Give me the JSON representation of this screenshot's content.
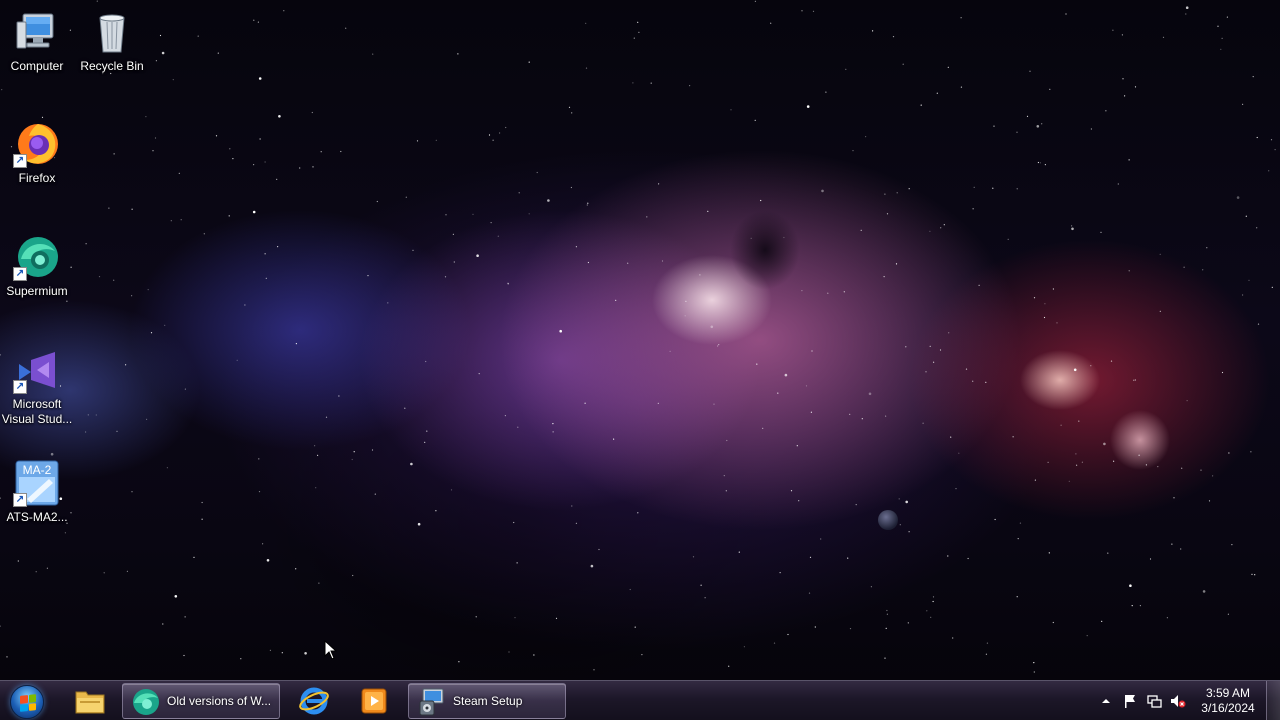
{
  "desktop": {
    "icons": [
      {
        "label": "Computer",
        "icon": "computer-icon"
      },
      {
        "label": "Recycle Bin",
        "icon": "recycle-bin-icon"
      },
      {
        "label": "Firefox",
        "icon": "firefox-icon"
      },
      {
        "label": "Supermium",
        "icon": "supermium-icon"
      },
      {
        "label": "Microsoft\nVisual Stud...",
        "line1": "Microsoft",
        "line2": "Visual Stud...",
        "icon": "visual-studio-icon"
      },
      {
        "label": "ATS-MA2...",
        "icon": "ats-ma2-icon",
        "badge": "MA-2"
      }
    ]
  },
  "taskbar": {
    "start_button": {
      "icon": "windows-start-orb-icon"
    },
    "pinned": [
      {
        "name": "File Explorer",
        "icon": "folder-icon"
      },
      {
        "name": "Internet Explorer",
        "icon": "internet-explorer-icon"
      },
      {
        "name": "Media Player",
        "icon": "media-player-icon"
      }
    ],
    "tasks": [
      {
        "title": "Old versions of W...",
        "icon": "supermium-icon"
      },
      {
        "title": "Steam Setup",
        "icon": "steam-setup-icon"
      }
    ],
    "tray": {
      "icons": [
        "show-hidden-icons-chevron",
        "action-center-flag-icon",
        "network-icon",
        "volume-muted-icon"
      ],
      "time": "3:59 AM",
      "date": "3/16/2024"
    }
  },
  "colors": {
    "taskbar": "#1e182a",
    "start_orb": "#1c5fb5",
    "label_text": "#ffffff"
  }
}
